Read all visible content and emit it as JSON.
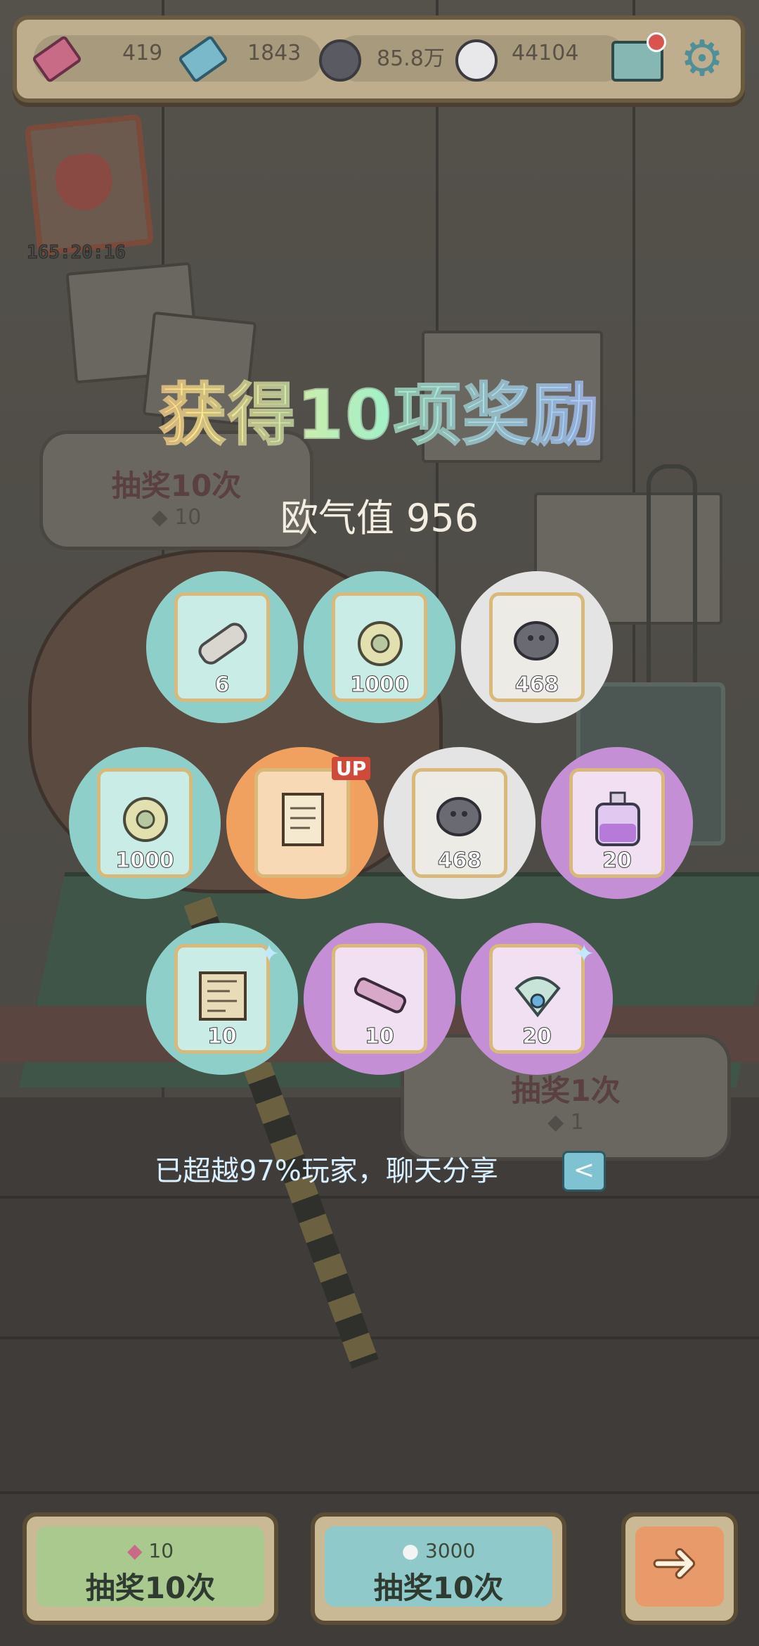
{
  "topbar": {
    "resources": [
      {
        "name": "ticket-pink",
        "value": "419"
      },
      {
        "name": "ticket-blue",
        "value": "1843"
      },
      {
        "name": "bubble-dark",
        "value": "85.8万"
      },
      {
        "name": "bubble-white",
        "value": "44104"
      }
    ],
    "icons": [
      "ticket-icon",
      "blue-ticket-icon",
      "dark-bubble-icon",
      "white-bubble-icon",
      "mail-icon",
      "gear-icon"
    ]
  },
  "event": {
    "timer": "165:20:16"
  },
  "background": {
    "left_button": {
      "label": "抽奖10次",
      "cost": "10"
    },
    "right_button": {
      "label": "抽奖1次",
      "cost": "1"
    }
  },
  "result": {
    "title": "获得10项奖励",
    "luck_label": "欧气值 956"
  },
  "rewards": [
    {
      "item": "scroll",
      "rarity": "teal",
      "qty": "6"
    },
    {
      "item": "mold-coin",
      "rarity": "teal",
      "qty": "1000"
    },
    {
      "item": "dark-bubble",
      "rarity": "white",
      "qty": "468"
    },
    {
      "item": "mold-coin",
      "rarity": "teal",
      "qty": "1000"
    },
    {
      "item": "recipe-scroll",
      "rarity": "orange",
      "qty": "",
      "badge": "UP"
    },
    {
      "item": "dark-bubble",
      "rarity": "white",
      "qty": "468"
    },
    {
      "item": "potion",
      "rarity": "purple",
      "qty": "20"
    },
    {
      "item": "map",
      "rarity": "teal",
      "qty": "10"
    },
    {
      "item": "telescope",
      "rarity": "purple",
      "qty": "10"
    },
    {
      "item": "peacock-ornament",
      "rarity": "purple",
      "qty": "20"
    }
  ],
  "share": {
    "text": "已超越97%玩家，聊天分享"
  },
  "buttons": {
    "draw10_ticket": {
      "cost": "10",
      "label": "抽奖10次"
    },
    "draw10_bubble": {
      "cost": "3000",
      "label": "抽奖10次"
    }
  },
  "colors": {
    "teal": "#8fcfc9",
    "white": "#e4e4e4",
    "purple": "#c58fd6",
    "orange": "#f0a160"
  }
}
